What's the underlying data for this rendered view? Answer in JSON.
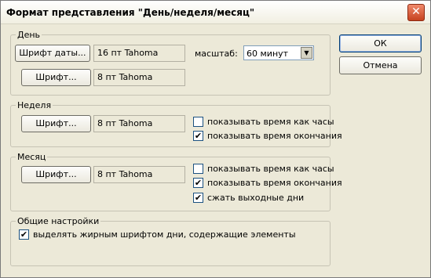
{
  "window": {
    "title": "Формат представления \"День/неделя/месяц\"",
    "close_label": "✕"
  },
  "day": {
    "legend": "День",
    "date_font_button": "Шрифт даты...",
    "date_font_value": "16 пт Tahoma",
    "font_button": "Шрифт...",
    "font_value": "8 пт Tahoma",
    "scale_label": "масштаб:",
    "scale_value": "60 минут"
  },
  "week": {
    "legend": "Неделя",
    "font_button": "Шрифт...",
    "font_value": "8 пт Tahoma",
    "options": [
      {
        "label": "показывать время как часы",
        "checked": false
      },
      {
        "label": "показывать время окончания",
        "checked": true
      }
    ]
  },
  "month": {
    "legend": "Месяц",
    "font_button": "Шрифт...",
    "font_value": "8 пт Tahoma",
    "options": [
      {
        "label": "показывать время как часы",
        "checked": false
      },
      {
        "label": "показывать время окончания",
        "checked": true
      },
      {
        "label": "сжать выходные дни",
        "checked": true
      }
    ]
  },
  "general": {
    "legend": "Общие настройки",
    "options": [
      {
        "label": "выделять жирным шрифтом дни, содержащие элементы",
        "checked": true
      }
    ]
  },
  "buttons": {
    "ok": "ОК",
    "cancel": "Отмена"
  },
  "check_mark": "✔"
}
